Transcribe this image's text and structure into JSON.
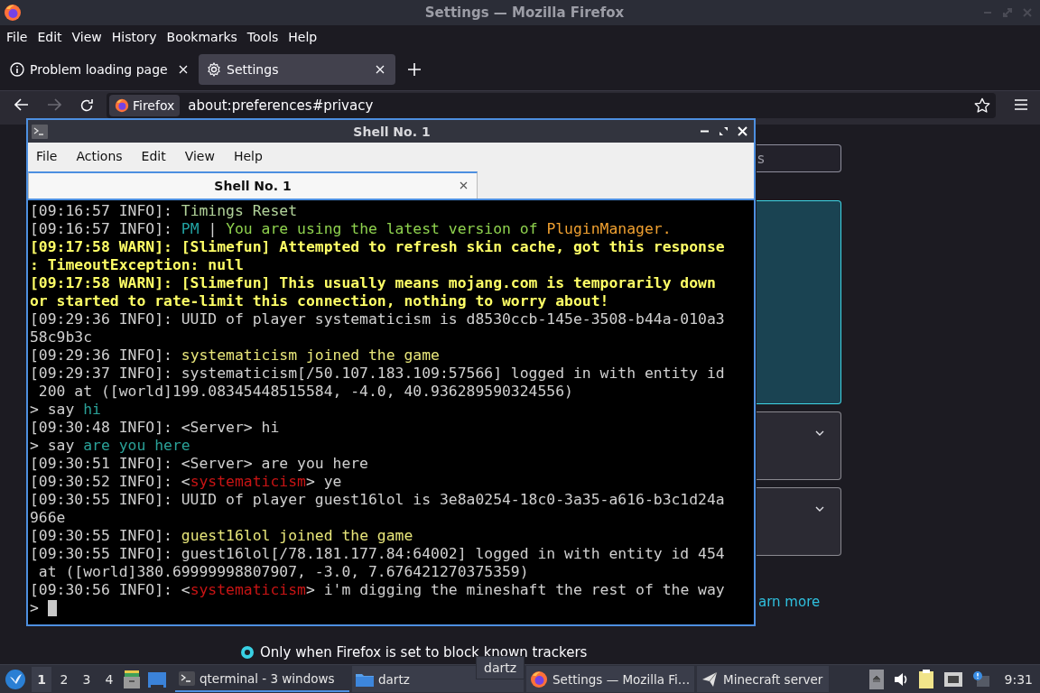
{
  "firefox": {
    "window_title": "Settings — Mozilla Firefox",
    "menu": [
      "File",
      "Edit",
      "View",
      "History",
      "Bookmarks",
      "Tools",
      "Help"
    ],
    "tabs": [
      {
        "label": "Problem loading page",
        "kind": "info",
        "selected": false
      },
      {
        "label": "Settings",
        "kind": "gear",
        "selected": true
      }
    ],
    "identity_label": "Firefox",
    "url": "about:preferences#privacy",
    "search": {
      "placeholder": "s"
    },
    "learn_more_link": "arn more",
    "radios": [
      {
        "label": "Only when Firefox is set to block known trackers",
        "selected": true
      }
    ]
  },
  "terminal": {
    "title": "Shell No. 1",
    "menu": [
      "File",
      "Actions",
      "Edit",
      "View",
      "Help"
    ],
    "tabs": [
      {
        "label": "Shell No. 1",
        "selected": true
      }
    ],
    "lines": [
      {
        "segments": [
          {
            "text": "[09:16:57 INFO]: ",
            "color": "#d0d0d0",
            "bold": false
          },
          {
            "text": "Timings Reset",
            "color": "#b2d39a",
            "bold": false
          }
        ]
      },
      {
        "segments": [
          {
            "text": "[09:16:57 INFO]: ",
            "color": "#d0d0d0",
            "bold": false
          },
          {
            "text": "PM",
            "color": "#22a3a3",
            "bold": false
          },
          {
            "text": " | ",
            "color": "#d0d0d0",
            "bold": false
          },
          {
            "text": "You are using the latest version of ",
            "color": "#8fd24e",
            "bold": false
          },
          {
            "text": "PluginManager.",
            "color": "#f0a030",
            "bold": false
          }
        ]
      },
      {
        "segments": [
          {
            "text": "[09:17:58 WARN]: [Slimefun] Attempted to refresh skin cache, got this response",
            "color": "#ffff66",
            "bold": true
          }
        ]
      },
      {
        "segments": [
          {
            "text": ": TimeoutException: null",
            "color": "#ffff66",
            "bold": true
          }
        ]
      },
      {
        "segments": [
          {
            "text": "[09:17:58 WARN]: [Slimefun] This usually means mojang.com is temporarily down",
            "color": "#ffff66",
            "bold": true
          }
        ]
      },
      {
        "segments": [
          {
            "text": "or started to rate-limit this connection, nothing to worry about!",
            "color": "#ffff66",
            "bold": true
          }
        ]
      },
      {
        "segments": [
          {
            "text": "[09:29:36 INFO]: UUID of player systematicism is d8530ccb-145e-3508-b44a-010a3",
            "color": "#d0d0d0",
            "bold": false
          }
        ]
      },
      {
        "segments": [
          {
            "text": "58c9b3c",
            "color": "#d0d0d0",
            "bold": false
          }
        ]
      },
      {
        "segments": [
          {
            "text": "[09:29:36 INFO]: ",
            "color": "#d0d0d0",
            "bold": false
          },
          {
            "text": "systematicism joined the game",
            "color": "#e8e67a",
            "bold": false
          }
        ]
      },
      {
        "segments": [
          {
            "text": "[09:29:37 INFO]: systematicism[/50.107.183.109:57566] logged in with entity id",
            "color": "#d0d0d0",
            "bold": false
          }
        ]
      },
      {
        "segments": [
          {
            "text": " 200 at ([world]199.08345448515584, -4.0, 40.936289590324556)",
            "color": "#d0d0d0",
            "bold": false
          }
        ]
      },
      {
        "segments": [
          {
            "text": "> say ",
            "color": "#d0d0d0",
            "bold": false
          },
          {
            "text": "hi",
            "color": "#2aa198",
            "bold": false
          }
        ]
      },
      {
        "segments": [
          {
            "text": "[09:30:48 INFO]: <Server> hi",
            "color": "#d0d0d0",
            "bold": false
          }
        ]
      },
      {
        "segments": [
          {
            "text": "> say ",
            "color": "#d0d0d0",
            "bold": false
          },
          {
            "text": "are you here",
            "color": "#2aa198",
            "bold": false
          }
        ]
      },
      {
        "segments": [
          {
            "text": "[09:30:51 INFO]: <Server> are you here",
            "color": "#d0d0d0",
            "bold": false
          }
        ]
      },
      {
        "segments": [
          {
            "text": "[09:30:52 INFO]: <",
            "color": "#d0d0d0",
            "bold": false
          },
          {
            "text": "systematicism",
            "color": "#c81414",
            "bold": false
          },
          {
            "text": "> ye",
            "color": "#d0d0d0",
            "bold": false
          }
        ]
      },
      {
        "segments": [
          {
            "text": "[09:30:55 INFO]: UUID of player guest16lol is 3e8a0254-18c0-3a35-a616-b3c1d24a",
            "color": "#d0d0d0",
            "bold": false
          }
        ]
      },
      {
        "segments": [
          {
            "text": "966e",
            "color": "#d0d0d0",
            "bold": false
          }
        ]
      },
      {
        "segments": [
          {
            "text": "[09:30:55 INFO]: ",
            "color": "#d0d0d0",
            "bold": false
          },
          {
            "text": "guest16lol joined the game",
            "color": "#e8e67a",
            "bold": false
          }
        ]
      },
      {
        "segments": [
          {
            "text": "[09:30:55 INFO]: guest16lol[/78.181.177.84:64002] logged in with entity id 454",
            "color": "#d0d0d0",
            "bold": false
          }
        ]
      },
      {
        "segments": [
          {
            "text": " at ([world]380.69999998807907, -3.0, 7.676421270375359)",
            "color": "#d0d0d0",
            "bold": false
          }
        ]
      },
      {
        "segments": [
          {
            "text": "[09:30:56 INFO]: <",
            "color": "#d0d0d0",
            "bold": false
          },
          {
            "text": "systematicism",
            "color": "#c81414",
            "bold": false
          },
          {
            "text": "> i'm digging the mineshaft the rest of the way",
            "color": "#d0d0d0",
            "bold": false
          }
        ]
      }
    ],
    "prompt": ">"
  },
  "taskbar": {
    "workspaces": [
      {
        "label": "1",
        "selected": true
      },
      {
        "label": "2",
        "selected": false
      },
      {
        "label": "3",
        "selected": false
      },
      {
        "label": "4",
        "selected": false
      }
    ],
    "tasks": [
      {
        "label": "qterminal - 3 windows",
        "kind": "terminal",
        "selected": true
      },
      {
        "label": "dartz",
        "kind": "folder",
        "selected": false
      },
      {
        "label": "Settings — Mozilla Fi…",
        "kind": "firefox",
        "selected": false
      },
      {
        "label": "Minecraft server",
        "kind": "plane",
        "selected": false
      }
    ],
    "tooltip": "dartz",
    "clock": "9:31"
  }
}
